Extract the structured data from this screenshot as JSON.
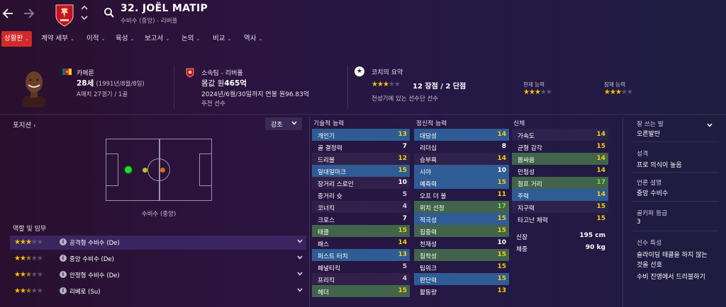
{
  "header": {
    "player_name": "32. JOËL MATIP",
    "subtitle": "수비수 (중앙) - 리버풀",
    "back_icon": "arrow-left-icon",
    "forward_icon": "arrow-right-icon",
    "search_icon": "search-icon"
  },
  "tabs": [
    {
      "label": "상황판",
      "active": true,
      "chev": "⌄"
    },
    {
      "label": "계약 세부",
      "chev": "⌄"
    },
    {
      "label": "이적",
      "chev": "⌄"
    },
    {
      "label": "육성",
      "chev": "⌄"
    },
    {
      "label": "보고서",
      "chev": "⌄"
    },
    {
      "label": "논의",
      "chev": "⌄"
    },
    {
      "label": "비교",
      "chev": "⌄"
    },
    {
      "label": "역사",
      "chev": "⌄"
    }
  ],
  "info": {
    "nation": "카메룬",
    "age": "28세",
    "dob": "(1991년/8월/8일)",
    "caps": "A매치 27경기 / 1골",
    "club": "소속팀 - 리버풀",
    "value_prefix": "몸값 원",
    "value": "465억",
    "contract": "2024년/6월/30일까지 연봉 원96.83억",
    "squad_status": "주전 선수",
    "coach_title": "코치의 요약",
    "coach_stars": 3,
    "coach_rating": "12 장점 / 2 단점",
    "coach_note": "전성기에 있는 선수단 선수",
    "current_ability_label": "현재 능력",
    "current_ability_stars": 3,
    "potential_ability_label": "잠재 능력",
    "potential_ability_stars": 3
  },
  "left": {
    "position_title": "포지션",
    "highlight_label": "강조",
    "position_caption": "수비수 (중앙)",
    "roles_title": "역할 및 임무",
    "roles": [
      {
        "label": "공격형 수비수 (De)",
        "stars": 3,
        "half": false,
        "selected": true
      },
      {
        "label": "중앙 수비수 (De)",
        "stars": 2,
        "half": true,
        "selected": false
      },
      {
        "label": "안정형 수비수 (De)",
        "stars": 2,
        "half": true,
        "selected": false
      },
      {
        "label": "리베로 (Su)",
        "stars": 2,
        "half": true,
        "selected": false
      }
    ],
    "colors": {
      "primary_dot": "#2fd43a",
      "secondary_dot": "#b9c21c",
      "tertiary_dot": "#e06a14"
    }
  },
  "attributes": {
    "technical_title": "기술적 능력",
    "mental_title": "정신적 능력",
    "physical_title": "신체",
    "technical": [
      {
        "name": "개인기",
        "value": "13",
        "hl": "blue"
      },
      {
        "name": "골 결정력",
        "value": "7",
        "hl": ""
      },
      {
        "name": "드리블",
        "value": "12",
        "hl": ""
      },
      {
        "name": "일대일마크",
        "value": "15",
        "hl": "blue"
      },
      {
        "name": "장거리 스로인",
        "value": "10",
        "hl": ""
      },
      {
        "name": "중거리 슛",
        "value": "5",
        "hl": ""
      },
      {
        "name": "코너킥",
        "value": "4",
        "hl": ""
      },
      {
        "name": "크로스",
        "value": "7",
        "hl": ""
      },
      {
        "name": "태클",
        "value": "15",
        "hl": "green"
      },
      {
        "name": "패스",
        "value": "14",
        "hl": ""
      },
      {
        "name": "퍼스트 터치",
        "value": "13",
        "hl": "blue"
      },
      {
        "name": "페널티킥",
        "value": "5",
        "hl": ""
      },
      {
        "name": "프리킥",
        "value": "4",
        "hl": ""
      },
      {
        "name": "헤더",
        "value": "15",
        "hl": "green"
      }
    ],
    "mental": [
      {
        "name": "대담성",
        "value": "14",
        "hl": "blue"
      },
      {
        "name": "리더십",
        "value": "8",
        "hl": ""
      },
      {
        "name": "승부욕",
        "value": "14",
        "hl": ""
      },
      {
        "name": "시야",
        "value": "10",
        "hl": "blue"
      },
      {
        "name": "예측력",
        "value": "15",
        "hl": "blue"
      },
      {
        "name": "오프 더 볼",
        "value": "11",
        "hl": ""
      },
      {
        "name": "위치 선정",
        "value": "17",
        "hl": "green"
      },
      {
        "name": "적극성",
        "value": "15",
        "hl": "blue"
      },
      {
        "name": "집중력",
        "value": "15",
        "hl": "green"
      },
      {
        "name": "천재성",
        "value": "10",
        "hl": ""
      },
      {
        "name": "침착성",
        "value": "15",
        "hl": "green"
      },
      {
        "name": "팀워크",
        "value": "15",
        "hl": ""
      },
      {
        "name": "판단력",
        "value": "15",
        "hl": "blue"
      },
      {
        "name": "활동량",
        "value": "13",
        "hl": ""
      }
    ],
    "physical": [
      {
        "name": "가속도",
        "value": "14",
        "hl": ""
      },
      {
        "name": "균형 감각",
        "value": "15",
        "hl": ""
      },
      {
        "name": "몸싸움",
        "value": "14",
        "hl": "green"
      },
      {
        "name": "민첩성",
        "value": "14",
        "hl": ""
      },
      {
        "name": "점프 거리",
        "value": "17",
        "hl": "green"
      },
      {
        "name": "주력",
        "value": "14",
        "hl": "blue"
      },
      {
        "name": "지구력",
        "value": "15",
        "hl": ""
      },
      {
        "name": "타고난 체력",
        "value": "15",
        "hl": ""
      }
    ],
    "height_label": "신장",
    "height": "195 cm",
    "weight_label": "체중",
    "weight": "90 kg"
  },
  "right": {
    "foot_label": "잘 쓰는 발",
    "foot_value": "오른발만",
    "personality_label": "성격",
    "personality_value": "프로 의식이 높음",
    "media_label": "언론 설명",
    "media_value": "중앙 수비수",
    "gk_label": "골키퍼 등급",
    "gk_value": "3",
    "traits_label": "선수 특성",
    "trait1": "슬라이딩 태클을 하지 않는",
    "trait1b": "것을 선호",
    "trait2": "수비 진영에서 드리블하기"
  },
  "colors": {
    "accent_red": "#d12a2a",
    "highlight_blue": "#2f5c94",
    "highlight_green": "#41644a",
    "value_yellow": "#f3cc18",
    "value_green": "#7bdc3c",
    "star_gold": "#f3c400"
  }
}
